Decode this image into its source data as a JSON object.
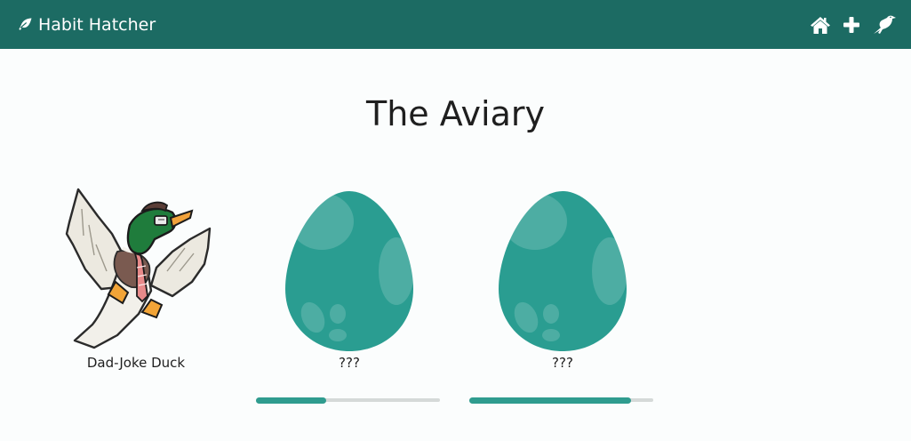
{
  "app": {
    "brand_name": "Habit Hatcher",
    "brand_icon": "feather-icon",
    "nav_icons": [
      "home-icon",
      "plus-icon",
      "crow-icon"
    ],
    "colors": {
      "navbar": "#1c6b63",
      "egg": "#2a9d91",
      "progress": "#2f9c8f",
      "track": "#d5d9d8"
    }
  },
  "page": {
    "title": "The Aviary"
  },
  "birds": [
    {
      "name": "Dad-Joke Duck",
      "state": "hatched",
      "image": "duck"
    },
    {
      "name": "???",
      "state": "egg",
      "progress": 0.38
    },
    {
      "name": "???",
      "state": "egg",
      "progress": 0.88
    }
  ]
}
